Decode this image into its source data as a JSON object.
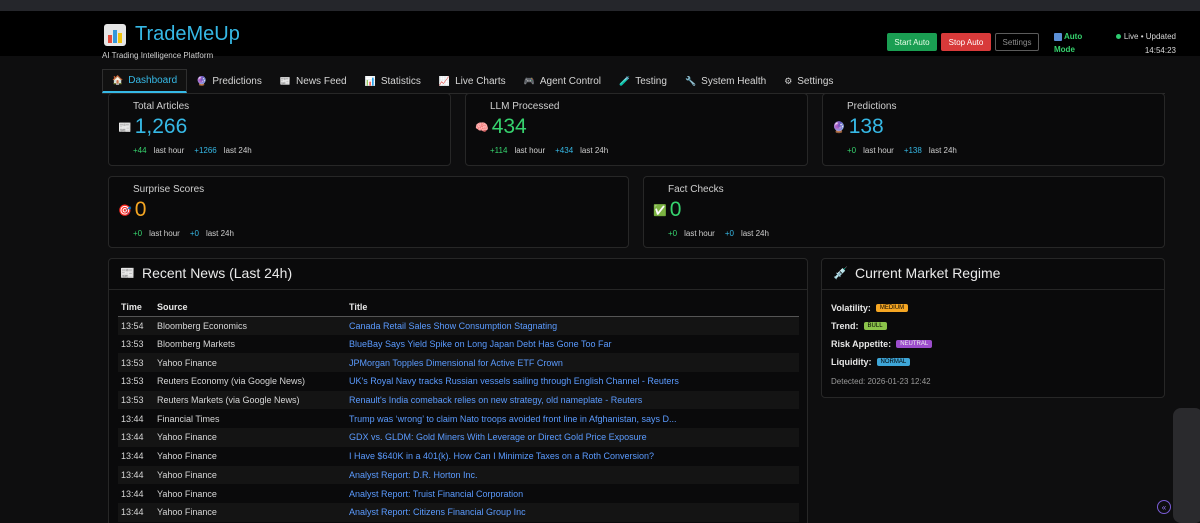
{
  "header": {
    "title": "TradeMeUp",
    "tagline": "AI Trading Intelligence Platform",
    "start_label": "Start Auto",
    "stop_label": "Stop Auto",
    "settings_label": "Settings",
    "auto_mode_line1": "Auto",
    "auto_mode_line2": "Mode",
    "live_label": "Live • Updated",
    "updated_time": "14:54:23"
  },
  "tabs": [
    {
      "label": "Dashboard",
      "icon": "🏠",
      "active": true
    },
    {
      "label": "Predictions",
      "icon": "🔮"
    },
    {
      "label": "News Feed",
      "icon": "📰"
    },
    {
      "label": "Statistics",
      "icon": "📊"
    },
    {
      "label": "Live Charts",
      "icon": "📈"
    },
    {
      "label": "Agent Control",
      "icon": "🎮"
    },
    {
      "label": "Testing",
      "icon": "🧪"
    },
    {
      "label": "System Health",
      "icon": "🔧"
    },
    {
      "label": "Settings",
      "icon": "⚙"
    }
  ],
  "stats": [
    {
      "label": "Total Articles",
      "value": "1,266",
      "icon": "📰",
      "hour": "+44",
      "day": "+1266",
      "hour_label": "last hour",
      "day_label": "last 24h",
      "color": "#36b9e6"
    },
    {
      "label": "LLM Processed",
      "value": "434",
      "icon": "🧠",
      "hour": "+114",
      "day": "+434",
      "hour_label": "last hour",
      "day_label": "last 24h",
      "color": "#36d36e"
    },
    {
      "label": "Predictions",
      "value": "138",
      "icon": "🔮",
      "hour": "+0",
      "day": "+138",
      "hour_label": "last hour",
      "day_label": "last 24h",
      "color": "#36b9e6"
    },
    {
      "label": "Surprise Scores",
      "value": "0",
      "icon": "🎯",
      "hour": "+0",
      "day": "+0",
      "hour_label": "last hour",
      "day_label": "last 24h",
      "color": "#f5a623"
    },
    {
      "label": "Fact Checks",
      "value": "0",
      "icon": "✅",
      "hour": "+0",
      "day": "+0",
      "hour_label": "last hour",
      "day_label": "last 24h",
      "color": "#36d36e"
    }
  ],
  "news": {
    "title": "Recent News (Last 24h)",
    "columns": [
      "Time",
      "Source",
      "Title"
    ],
    "rows": [
      [
        "13:54",
        "Bloomberg Economics",
        "Canada Retail Sales Show Consumption Stagnating"
      ],
      [
        "13:53",
        "Bloomberg Markets",
        "BlueBay Says Yield Spike on Long Japan Debt Has Gone Too Far"
      ],
      [
        "13:53",
        "Yahoo Finance",
        "JPMorgan Topples Dimensional for Active ETF Crown"
      ],
      [
        "13:53",
        "Reuters Economy (via Google News)",
        "UK's Royal Navy tracks Russian vessels sailing through English Channel - Reuters"
      ],
      [
        "13:53",
        "Reuters Markets (via Google News)",
        "Renault's India comeback relies on new strategy, old nameplate - Reuters"
      ],
      [
        "13:44",
        "Financial Times",
        "Trump was ‘wrong’ to claim Nato troops avoided front line in Afghanistan, says D..."
      ],
      [
        "13:44",
        "Yahoo Finance",
        "GDX vs. GLDM: Gold Miners With Leverage or Direct Gold Price Exposure"
      ],
      [
        "13:44",
        "Yahoo Finance",
        "I Have $640K in a 401(k). How Can I Minimize Taxes on a Roth Conversion?"
      ],
      [
        "13:44",
        "Yahoo Finance",
        "Analyst Report: D.R. Horton Inc."
      ],
      [
        "13:44",
        "Yahoo Finance",
        "Analyst Report: Truist Financial Corporation"
      ],
      [
        "13:44",
        "Yahoo Finance",
        "Analyst Report: Citizens Financial Group Inc"
      ]
    ]
  },
  "regime": {
    "title": "Current Market Regime",
    "items": [
      {
        "label": "Volatility:",
        "badge": "MEDIUM",
        "color": "#f5a623"
      },
      {
        "label": "Trend:",
        "badge": "BULL",
        "color": "#8bc34a"
      },
      {
        "label": "Risk Appetite:",
        "badge": "NEUTRAL",
        "color": "#9c4dcc"
      },
      {
        "label": "Liquidity:",
        "badge": "NORMAL",
        "color": "#3ea6d8"
      }
    ],
    "detected": "Detected: 2026-01-23 12:42"
  }
}
